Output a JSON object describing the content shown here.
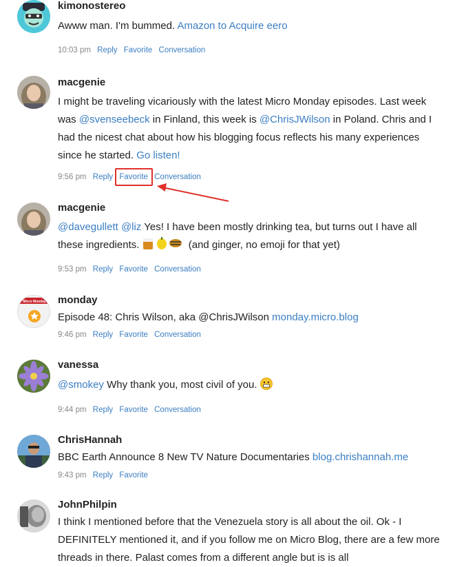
{
  "posts": [
    {
      "username": "kimonostereo",
      "text_parts": [
        {
          "t": "Awww man. I'm bummed. ",
          "link": false
        },
        {
          "t": "Amazon to Acquire eero",
          "link": true
        }
      ],
      "time": "10:03 pm",
      "actions": [
        "Reply",
        "Favorite",
        "Conversation"
      ]
    },
    {
      "username": "macgenie",
      "text_parts": [
        {
          "t": "I might be traveling vicariously with the latest Micro Monday episodes. Last week was ",
          "link": false
        },
        {
          "t": "@svenseebeck",
          "link": true
        },
        {
          "t": " in Finland, this week is ",
          "link": false
        },
        {
          "t": "@ChrisJWilson",
          "link": true
        },
        {
          "t": " in Poland. Chris and I had the nicest chat about how his blogging focus reflects his many experiences since he started. ",
          "link": false
        },
        {
          "t": "Go listen!",
          "link": true
        }
      ],
      "time": "9:56 pm",
      "actions": [
        "Reply",
        "Favorite",
        "Conversation"
      ]
    },
    {
      "username": "macgenie",
      "text_parts": [
        {
          "t": "@davegullett",
          "link": true
        },
        {
          "t": " ",
          "link": false
        },
        {
          "t": "@liz",
          "link": true
        },
        {
          "t": " Yes! I have been mostly drinking tea, but turns out I have all these ingredients. ",
          "link": false
        },
        {
          "t": "[emoji]",
          "link": false
        },
        {
          "t": " (and ginger, no emoji for that yet)",
          "link": false
        }
      ],
      "time": "9:53 pm",
      "actions": [
        "Reply",
        "Favorite",
        "Conversation"
      ]
    },
    {
      "username": "monday",
      "text_parts": [
        {
          "t": "Episode 48: Chris Wilson, aka @ChrisJWilson ",
          "link": false
        },
        {
          "t": "monday.micro.blog",
          "link": true
        }
      ],
      "time": "9:46 pm",
      "actions": [
        "Reply",
        "Favorite",
        "Conversation"
      ]
    },
    {
      "username": "vanessa",
      "text_parts": [
        {
          "t": "@smokey",
          "link": true
        },
        {
          "t": " Why thank you, most civil of you. ",
          "link": false
        },
        {
          "t": "[grin]",
          "link": false
        }
      ],
      "time": "9:44 pm",
      "actions": [
        "Reply",
        "Favorite",
        "Conversation"
      ]
    },
    {
      "username": "ChrisHannah",
      "text_parts": [
        {
          "t": "BBC Earth Announce 8 New TV Nature Documentaries ",
          "link": false
        },
        {
          "t": "blog.chrishannah.me",
          "link": true
        }
      ],
      "time": "9:43 pm",
      "actions": [
        "Reply",
        "Favorite"
      ]
    },
    {
      "username": "JohnPhilpin",
      "text_parts": [
        {
          "t": "I think I mentioned before that the Venezuela story is all about the oil. Ok - I DEFINITELY mentioned it, and if you follow me on Micro Blog, there are a few more threads in there. Palast comes from a different angle but is is all",
          "link": false
        }
      ],
      "time": "",
      "actions": []
    }
  ],
  "monday_avatar_label": "Micro Monday",
  "colors": {
    "link": "#3b7ec2",
    "highlight": "#e0302a",
    "meta": "#888888"
  }
}
